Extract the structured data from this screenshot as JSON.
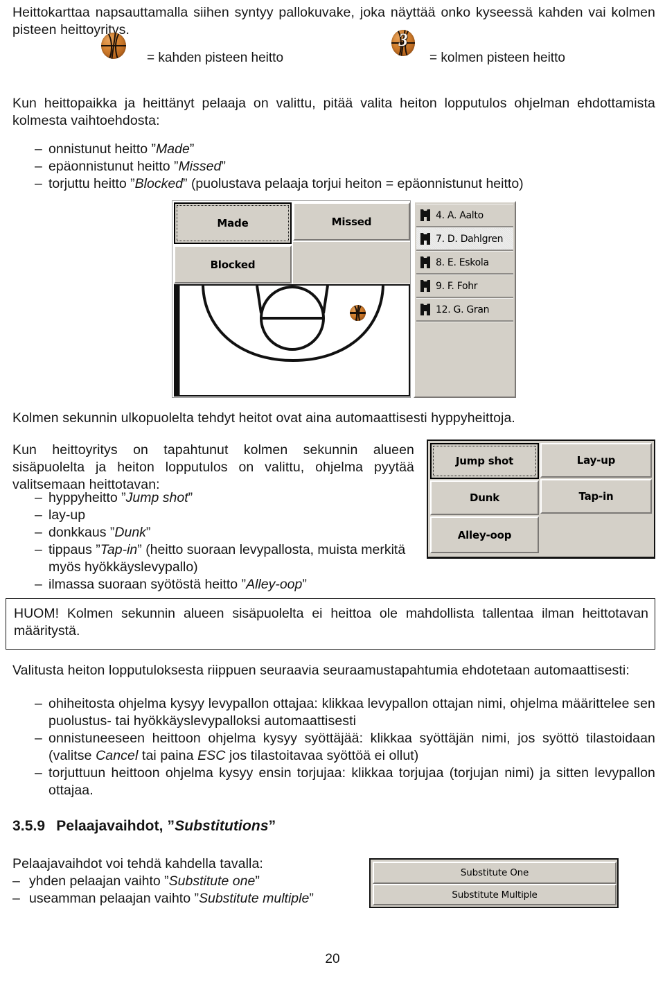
{
  "document": {
    "page_number": "20",
    "intro": {
      "paragraph": "Heittokarttaa napsauttamalla siihen syntyy pallokuvake, joka näyttää onko kyseessä kahden vai kolmen pisteen heittoyritys.",
      "legend_two_points": "= kahden pisteen heitto",
      "legend_three_points": "= kolmen pisteen heitto",
      "three_ball_label": "3"
    },
    "result_section": {
      "paragraph": "Kun heittopaikka ja heittänyt pelaaja on valittu, pitää valita heiton lopputulos ohjelman ehdottamista kolmesta vaihtoehdosta:",
      "bullets": [
        {
          "dash": "–",
          "pre": "onnistunut heitto ”",
          "em": "Made",
          "post": "”"
        },
        {
          "dash": "–",
          "pre": "epäonnistunut heitto ”",
          "em": "Missed",
          "post": "”"
        },
        {
          "dash": "–",
          "pre": "torjuttu heitto ”",
          "em": "Blocked",
          "post": "” (puolustava pelaaja torjui heiton = epäonnistunut heitto)"
        }
      ]
    },
    "result_screenshot": {
      "buttons": {
        "made": "Made",
        "missed": "Missed",
        "blocked": "Blocked",
        "empty": ""
      },
      "focused_button": "Made",
      "player_list": [
        {
          "label": "4. A. Aalto",
          "selected": false
        },
        {
          "label": "7. D. Dahlgren",
          "selected": true
        },
        {
          "label": "8. E. Eskola",
          "selected": false
        },
        {
          "label": "9. F. Fohr",
          "selected": false
        },
        {
          "label": "12. G. Gran",
          "selected": false
        }
      ]
    },
    "three_second_section": {
      "lead": "Kolmen sekunnin ulkopuolelta tehdyt heitot ovat aina automaattisesti hyppyheittoja.",
      "paragraph": "Kun heittoyritys on tapahtunut kolmen sekunnin alueen sisäpuolelta ja heiton lopputulos on valittu, ohjelma pyytää valitsemaan heittotavan:",
      "bullets": [
        {
          "dash": "–",
          "pre": "hyppyheitto ”",
          "em": "Jump shot",
          "post": "”"
        },
        {
          "dash": "–",
          "pre": "",
          "em": "",
          "post": "lay-up"
        },
        {
          "dash": "–",
          "pre": "donkkaus ”",
          "em": "Dunk",
          "post": "”"
        },
        {
          "dash": "–",
          "pre": "tippaus ”",
          "em": "Tap-in",
          "post": "” (heitto suoraan levypallosta, muista merkitä myös hyökkäyslevypallo)"
        },
        {
          "dash": "–",
          "pre": "ilmassa suoraan syötöstä heitto ”",
          "em": "Alley-oop",
          "post": "”"
        }
      ]
    },
    "shot_type_screenshot": {
      "buttons": {
        "jump_shot": "Jump shot",
        "lay_up": "Lay-up",
        "dunk": "Dunk",
        "tap_in": "Tap-in",
        "alley_oop": "Alley-oop",
        "empty": ""
      },
      "focused_button": "Jump shot"
    },
    "note": {
      "text": "HUOM! Kolmen sekunnin alueen sisäpuolelta ei heittoa ole mahdollista tallentaa ilman heittotavan määritystä."
    },
    "followup_section": {
      "paragraph": "Valitusta heiton lopputuloksesta riippuen seuraavia seuraamustapahtumia ehdotetaan automaattisesti:",
      "bullets": [
        {
          "dash": "–",
          "segments": [
            {
              "text": "ohiheitosta ohjelma kysyy levypallon ottajaa: klikkaa levypallon ottajan nimi, ohjelma määrittelee sen puolustus- tai hyökkäyslevypalloksi automaattisesti",
              "italic": false
            }
          ]
        },
        {
          "dash": "–",
          "segments": [
            {
              "text": "onnistuneeseen heittoon ohjelma kysyy syöttäjää: klikkaa syöttäjän nimi, jos syöttö tilastoidaan (valitse ",
              "italic": false
            },
            {
              "text": "Cancel",
              "italic": true
            },
            {
              "text": " tai paina ",
              "italic": false
            },
            {
              "text": "ESC",
              "italic": true
            },
            {
              "text": " jos tilastoitavaa syöttöä ei ollut)",
              "italic": false
            }
          ]
        },
        {
          "dash": "–",
          "segments": [
            {
              "text": "torjuttuun heittoon ohjelma kysyy ensin torjujaa: klikkaa torjujaa (torjujan nimi) ja sitten levypallon ottajaa.",
              "italic": false
            }
          ]
        }
      ]
    },
    "substitutions_section": {
      "heading_number": "3.5.9",
      "heading_pre": "Pelaajavaihdot, ”",
      "heading_em": "Substitutions",
      "heading_post": "”",
      "lead": "Pelaajavaihdot voi tehdä kahdella tavalla:",
      "bullets": [
        {
          "dash": "–",
          "pre": "yhden pelaajan vaihto ”",
          "em": "Substitute one",
          "post": "”"
        },
        {
          "dash": "–",
          "pre": "useamman pelaajan vaihto ”",
          "em": "Substitute multiple",
          "post": "”"
        }
      ],
      "screenshot": {
        "substitute_one": "Substitute One",
        "substitute_multiple": "Substitute Multiple"
      }
    }
  }
}
